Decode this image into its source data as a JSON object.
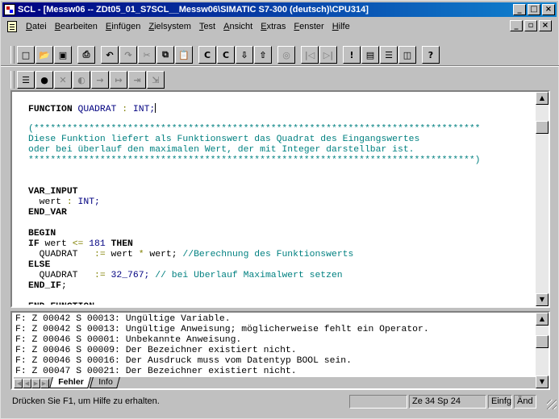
{
  "window": {
    "title": "SCL  - [Messw06 -- ZDt05_01_S7SCL__Messw06\\SIMATIC S7-300 (deutsch)\\CPU314]",
    "caption_buttons": [
      "_",
      "□",
      "×"
    ],
    "mdi_buttons": [
      "_",
      "▫",
      "×"
    ]
  },
  "menu": {
    "items": [
      "Datei",
      "Bearbeiten",
      "Einfügen",
      "Zielsystem",
      "Test",
      "Ansicht",
      "Extras",
      "Fenster",
      "Hilfe"
    ]
  },
  "toolbar1": {
    "buttons": [
      {
        "name": "new-icon",
        "glyph": "□"
      },
      {
        "name": "open-icon",
        "glyph": "📂"
      },
      {
        "name": "save-icon",
        "glyph": "▣"
      },
      {
        "name": "print-icon",
        "glyph": "⎙"
      },
      {
        "name": "undo-icon",
        "glyph": "↶"
      },
      {
        "name": "redo-icon",
        "glyph": "↷"
      },
      {
        "name": "cut-icon",
        "glyph": "✂"
      },
      {
        "name": "copy-icon",
        "glyph": "⧉"
      },
      {
        "name": "paste-icon",
        "glyph": "📋"
      },
      {
        "name": "compile-icon",
        "glyph": "C"
      },
      {
        "name": "compile-all-icon",
        "glyph": "C"
      },
      {
        "name": "download-icon",
        "glyph": "⇩"
      },
      {
        "name": "upload-icon",
        "glyph": "⇧"
      },
      {
        "name": "monitor-icon",
        "glyph": "◎"
      },
      {
        "name": "goto-start-icon",
        "glyph": "|◁"
      },
      {
        "name": "goto-end-icon",
        "glyph": "▷|"
      },
      {
        "name": "error-icon",
        "glyph": "!"
      },
      {
        "name": "cascade-icon",
        "glyph": "▤"
      },
      {
        "name": "tile-horizontal-icon",
        "glyph": "☰"
      },
      {
        "name": "tile-vertical-icon",
        "glyph": "◫"
      },
      {
        "name": "context-help-icon",
        "glyph": "?"
      }
    ]
  },
  "toolbar2": {
    "buttons": [
      {
        "name": "breakpoints-list-icon",
        "glyph": "☰"
      },
      {
        "name": "set-breakpoint-icon",
        "glyph": "●"
      },
      {
        "name": "delete-breakpoint-icon",
        "glyph": "✕"
      },
      {
        "name": "breakpoint-active-icon",
        "glyph": "◐"
      },
      {
        "name": "next-breakpoint-icon",
        "glyph": "→"
      },
      {
        "name": "run-to-cursor-icon",
        "glyph": "↦"
      },
      {
        "name": "step-icon",
        "glyph": "⇥"
      },
      {
        "name": "step-into-icon",
        "glyph": "⇲"
      }
    ]
  },
  "editor": {
    "lines": [
      [
        {
          "t": "FUNCTION",
          "c": "kw"
        },
        {
          "t": " QUADRAT ",
          "c": "typ"
        },
        {
          "t": ":",
          "c": "op"
        },
        {
          "t": " INT;",
          "c": "typ"
        }
      ],
      [],
      [
        {
          "t": "(*********************************************************************************",
          "c": "cm"
        }
      ],
      [
        {
          "t": "Diese Funktion liefert als Funktionswert das Quadrat des Eingangswertes",
          "c": "cm"
        }
      ],
      [
        {
          "t": "oder bei überlauf den maximalen Wert, der mit Integer darstellbar ist.",
          "c": "cm"
        }
      ],
      [
        {
          "t": "*********************************************************************************)",
          "c": "cm"
        }
      ],
      [],
      [],
      [
        {
          "t": "VAR_INPUT",
          "c": "kw"
        }
      ],
      [
        {
          "t": "  wert ",
          "c": ""
        },
        {
          "t": ":",
          "c": "op"
        },
        {
          "t": " INT;",
          "c": "typ"
        }
      ],
      [
        {
          "t": "END_VAR",
          "c": "kw"
        }
      ],
      [],
      [
        {
          "t": "BEGIN",
          "c": "kw"
        }
      ],
      [
        {
          "t": "IF",
          "c": "kw"
        },
        {
          "t": " wert ",
          "c": ""
        },
        {
          "t": "<=",
          "c": "op"
        },
        {
          "t": " 181 ",
          "c": "num"
        },
        {
          "t": "THEN",
          "c": "kw"
        }
      ],
      [
        {
          "t": "  QUADRAT   ",
          "c": ""
        },
        {
          "t": ":=",
          "c": "op"
        },
        {
          "t": " wert ",
          "c": ""
        },
        {
          "t": "*",
          "c": "op"
        },
        {
          "t": " wert; ",
          "c": ""
        },
        {
          "t": "//Berechnung des Funktionswerts",
          "c": "cm"
        }
      ],
      [
        {
          "t": "ELSE",
          "c": "kw"
        }
      ],
      [
        {
          "t": "  QUADRAT   ",
          "c": ""
        },
        {
          "t": ":=",
          "c": "op"
        },
        {
          "t": " 32_767; ",
          "c": "num"
        },
        {
          "t": "// bei Überlauf Maximalwert setzen",
          "c": "cm"
        }
      ],
      [
        {
          "t": "END_IF",
          "c": "kw"
        },
        {
          "t": ";",
          "c": ""
        }
      ],
      [],
      [
        {
          "t": "END_FUNCTION",
          "c": "kw"
        }
      ]
    ]
  },
  "output": {
    "lines": [
      "F: Z 00042 S 00013: Ungültige Variable.",
      "F: Z 00042 S 00013: Ungültige Anweisung; möglicherweise fehlt ein Operator.",
      "F: Z 00046 S 00001: Unbekannte Anweisung.",
      "F: Z 00046 S 00009: Der Bezeichner existiert nicht.",
      "F: Z 00046 S 00016: Der Ausdruck muss vom Datentyp BOOL sein.",
      "F: Z 00047 S 00021: Der Bezeichner existiert nicht."
    ],
    "tabs": [
      "Fehler",
      "Info"
    ]
  },
  "status": {
    "help_text": "Drücken Sie F1, um Hilfe zu erhalten.",
    "position": "Ze 34 Sp 24",
    "insert_mode": "Einfg",
    "changed": "Änd"
  }
}
